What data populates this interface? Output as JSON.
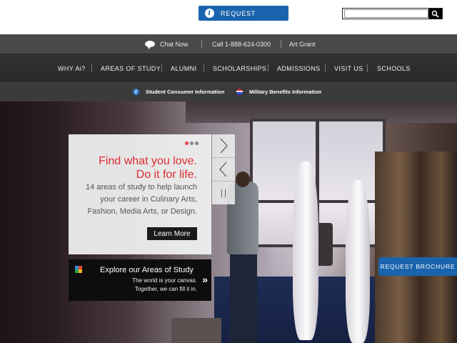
{
  "header": {
    "request_label": "REQUEST",
    "search": {
      "value": "",
      "placeholder": ""
    }
  },
  "utility_bar": {
    "chat_label": "Chat Now",
    "phone_label": "Call 1-888-624-0300",
    "art_grant_label": "Art Grant"
  },
  "main_nav": {
    "items": [
      {
        "label": "WHY Ai?"
      },
      {
        "label": "AREAS OF STUDY"
      },
      {
        "label": "ALUMNI"
      },
      {
        "label": "SCHOLARSHIPS"
      },
      {
        "label": "ADMISSIONS"
      },
      {
        "label": "VISIT US"
      },
      {
        "label": "SCHOOLS"
      }
    ]
  },
  "info_bar": {
    "consumer_info": "Student Consumer Information",
    "military_info": "Military Benefits Information"
  },
  "hero": {
    "headline_line1": "Find what you love.",
    "headline_line2": "Do it for life.",
    "sub_line1": "14 areas of study to help launch",
    "sub_line2": "your career in Culinary Arts,",
    "sub_line3": "Fashion, Media Arts, or Design.",
    "learn_more": "Learn More",
    "slide_count": 3,
    "active_slide": 1
  },
  "explore": {
    "title": "Explore our Areas of Study",
    "sub_line1": "The world is your canvas.",
    "sub_line2": "Together, we can fill it in."
  },
  "brochure_label": "REQUEST BROCHURE",
  "colors": {
    "brand_blue": "#1a64ae",
    "headline_red": "#dd2d32",
    "utility_bg": "#4a4a4a",
    "nav_bg": "#2f2f2f"
  },
  "icons": {
    "request": "info-icon",
    "search": "magnifier-icon",
    "chat": "chat-bubble-icon",
    "consumer": "info-circle-icon",
    "military": "flag-circle-icon",
    "explore": "color-grid-icon",
    "next": "chevron-right-icon",
    "prev": "chevron-left-icon",
    "pause": "pause-icon"
  }
}
